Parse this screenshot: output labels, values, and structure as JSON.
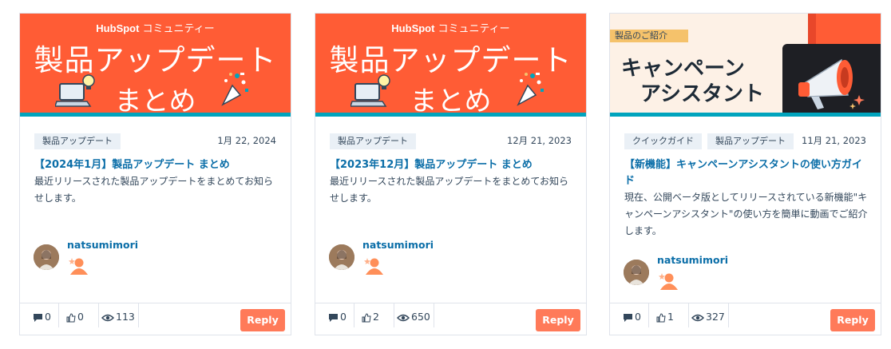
{
  "colors": {
    "banner_orange": "#ff5c35",
    "accent_teal": "#00a4bd",
    "link_blue": "#0b6ea8",
    "reply_orange": "#ff7a59"
  },
  "cards": [
    {
      "banner": {
        "logo": "HubSpot",
        "logo_suffix": "コミュニティー",
        "line1": "製品アップデート",
        "line2": "まとめ"
      },
      "tags": [
        "製品アップデート"
      ],
      "date": "1月 22, 2024",
      "title": "【2024年1月】製品アップデート まとめ",
      "description": "最近リリースされた製品アップデートをまとめてお知らせします。",
      "author": "natsumimori",
      "stats": {
        "comments": "0",
        "likes": "0",
        "views": "113"
      },
      "reply_label": "Reply"
    },
    {
      "banner": {
        "logo": "HubSpot",
        "logo_suffix": "コミュニティー",
        "line1": "製品アップデート",
        "line2": "まとめ"
      },
      "tags": [
        "製品アップデート"
      ],
      "date": "12月 21, 2023",
      "title": "【2023年12月】製品アップデート まとめ",
      "description": "最近リリースされた製品アップデートをまとめてお知らせします。",
      "author": "natsumimori",
      "stats": {
        "comments": "0",
        "likes": "2",
        "views": "650"
      },
      "reply_label": "Reply"
    },
    {
      "banner": {
        "tag": "製品のご紹介",
        "line1": "キャンペーン",
        "line2": "アシスタント"
      },
      "tags": [
        "クイックガイド",
        "製品アップデート"
      ],
      "date": "11月 21, 2023",
      "title": "【新機能】キャンペーンアシスタントの使い方ガイド",
      "description": "現在、公開ベータ版としてリリースされている新機能\"キャンペーンアシスタント\"の使い方を簡単に動画でご紹介します。",
      "author": "natsumimori",
      "stats": {
        "comments": "0",
        "likes": "1",
        "views": "327"
      },
      "reply_label": "Reply"
    }
  ]
}
